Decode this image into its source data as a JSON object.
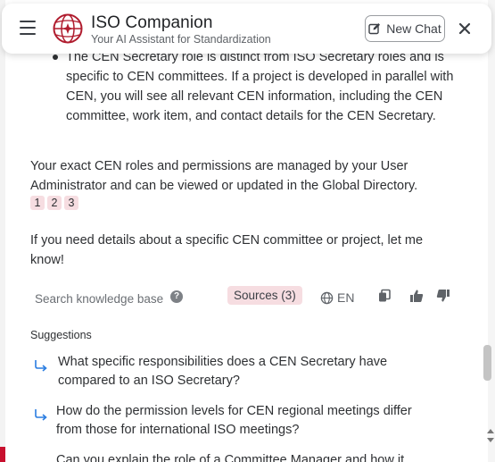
{
  "header": {
    "title": "ISO Companion",
    "subtitle": "Your AI Assistant for Standardization",
    "new_chat_label": "New Chat"
  },
  "message": {
    "bullet_text": "The CEN Secretary role is distinct from ISO Secretary roles and is specific to CEN committees. If a project is developed in parallel with CEN, you will see all relevant CEN information, including the CEN committee, work item, and contact details for the CEN Secretary.",
    "paragraph_1": "Your exact CEN roles and permissions are managed by your User Administrator and can be viewed or updated in the Global Directory.",
    "citations": [
      "1",
      "2",
      "3"
    ],
    "paragraph_2": "If you need details about a specific CEN committee or project, let me know!"
  },
  "toolbar": {
    "search_label": "Search knowledge base",
    "help_icon_glyph": "?",
    "sources_label": "Sources (3)",
    "language": "EN"
  },
  "suggestions": {
    "label": "Suggestions",
    "items": [
      "What specific responsibilities does a CEN Secretary have compared to an ISO Secretary?",
      "How do the permission levels for CEN regional meetings differ from those for international ISO meetings?",
      "Can you explain the role of a Committee Manager and how it"
    ]
  },
  "colors": {
    "accent": "#c8102e",
    "citation_bg": "#f6dde1",
    "suggestion_arrow": "#2a7de1"
  },
  "icons": [
    "hamburger-menu-icon",
    "iso-logo-icon",
    "edit-icon",
    "close-icon",
    "help-icon",
    "globe-icon",
    "copy-icon",
    "thumbs-up-icon",
    "thumbs-down-icon",
    "reply-arrow-icon"
  ]
}
